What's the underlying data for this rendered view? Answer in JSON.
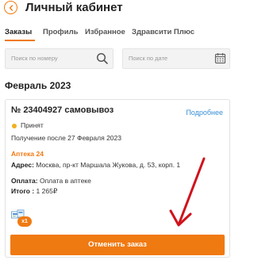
{
  "header": {
    "title": "Личный кабинет",
    "back_icon": "chevron-left-icon"
  },
  "tabs": [
    {
      "label": "Заказы",
      "active": true
    },
    {
      "label": "Профиль",
      "active": false
    },
    {
      "label": "Избранное",
      "active": false
    },
    {
      "label": "Здравсити Плюс",
      "active": false
    }
  ],
  "filters": {
    "number_placeholder": "Поиск по номеру",
    "date_placeholder": "Поиск по дате"
  },
  "month": "Февраль 2023",
  "order": {
    "title": "№ 23404927 самовывоз",
    "details_link": "Подробнее",
    "status": "Принят",
    "status_color": "#f2b01e",
    "pickup": "Получение после 27 Февраля 2023",
    "pharmacy": "Аптека 24",
    "address_label": "Адрес:",
    "address": "Москва, пр-кт Маршала Жукова, д. 53, корп. 1",
    "payment_label": "Оплата:",
    "payment": "Оплата в аптеке",
    "total_label": "Итого :",
    "total": "1 265₽",
    "qty_badge": "x1",
    "cancel_label": "Отменить заказ"
  },
  "colors": {
    "accent": "#f07a12",
    "link": "#3a8fd6",
    "arrow": "#d0121b"
  }
}
